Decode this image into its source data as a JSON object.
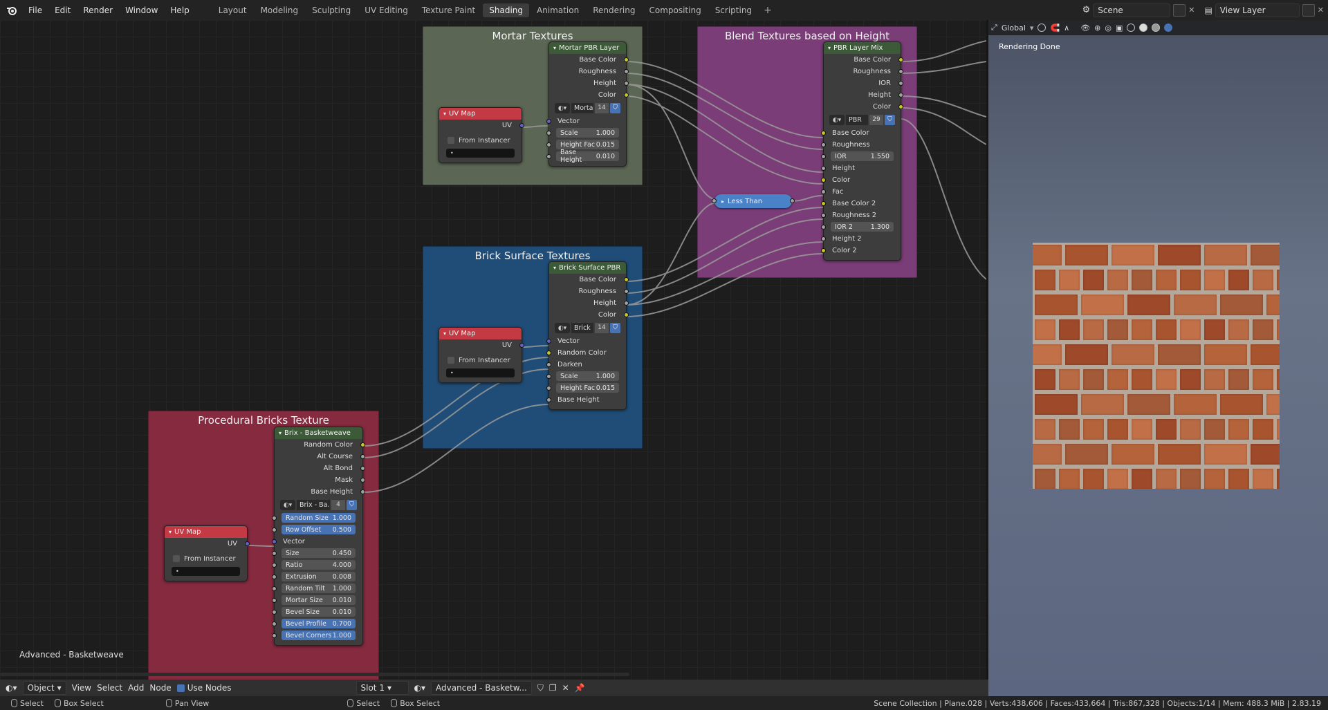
{
  "topbar": {
    "menus": [
      "File",
      "Edit",
      "Render",
      "Window",
      "Help"
    ],
    "workspaces": [
      "Layout",
      "Modeling",
      "Sculpting",
      "UV Editing",
      "Texture Paint",
      "Shading",
      "Animation",
      "Rendering",
      "Compositing",
      "Scripting"
    ],
    "active_workspace": "Shading",
    "scene": "Scene",
    "view_layer": "View Layer"
  },
  "frames": {
    "mortar": "Mortar Textures",
    "blend": "Blend Textures based on Height",
    "brick": "Brick Surface Textures",
    "proc": "Procedural Bricks Texture"
  },
  "mortar_node": {
    "title": "Mortar PBR Layer",
    "outputs": [
      "Base Color",
      "Roughness",
      "Height",
      "Color"
    ],
    "group_name": "Morta",
    "group_users": "14",
    "in_vector": "Vector",
    "fields": [
      {
        "label": "Scale",
        "value": "1.000"
      },
      {
        "label": "Height Fac",
        "value": "0.015"
      },
      {
        "label": "Base Height",
        "value": "0.010"
      }
    ]
  },
  "uvmap": {
    "title": "UV Map",
    "output": "UV",
    "from_instancer": "From Instancer",
    "uv_field": "•"
  },
  "brick_node": {
    "title": "Brick Surface PBR",
    "outputs": [
      "Base Color",
      "Roughness",
      "Height",
      "Color"
    ],
    "group_name": "Brick",
    "group_users": "14",
    "inputs": [
      "Vector",
      "Random Color",
      "Darken"
    ],
    "fields": [
      {
        "label": "Scale",
        "value": "1.000"
      },
      {
        "label": "Height Fac",
        "value": "0.015"
      }
    ],
    "in_base_height": "Base Height"
  },
  "mix_node": {
    "title": "PBR Layer Mix",
    "outputs": [
      "Base Color",
      "Roughness",
      "IOR",
      "Height",
      "Color"
    ],
    "group_name": "PBR",
    "group_users": "29",
    "inputs_a": [
      "Base Color",
      "Roughness"
    ],
    "ior": {
      "label": "IOR",
      "value": "1.550"
    },
    "inputs_b": [
      "Height",
      "Color",
      "Fac",
      "Base Color 2",
      "Roughness 2"
    ],
    "ior2": {
      "label": "IOR 2",
      "value": "1.300"
    },
    "inputs_c": [
      "Height 2",
      "Color 2"
    ]
  },
  "less_than": {
    "label": "Less Than"
  },
  "brix_node": {
    "title": "Brix - Basketweave",
    "outputs": [
      "Random Color",
      "Alt Course",
      "Alt Bond",
      "Mask",
      "Base Height"
    ],
    "group_name": "Brix - Ba...",
    "group_users": "4",
    "hl_fields": [
      {
        "label": "Random Size",
        "value": "1.000"
      },
      {
        "label": "Row Offset",
        "value": "0.500"
      }
    ],
    "in_vector": "Vector",
    "fields": [
      {
        "label": "Size",
        "value": "0.450"
      },
      {
        "label": "Ratio",
        "value": "4.000"
      },
      {
        "label": "Extrusion",
        "value": "0.008"
      },
      {
        "label": "Random Tilt",
        "value": "1.000"
      },
      {
        "label": "Mortar Size",
        "value": "0.010"
      },
      {
        "label": "Bevel Size",
        "value": "0.010"
      }
    ],
    "hl_fields2": [
      {
        "label": "Bevel Profile",
        "value": "0.700"
      },
      {
        "label": "Bevel Corners",
        "value": "1.000"
      }
    ]
  },
  "tree_name": "Advanced - Basketweave",
  "viewport": {
    "orientation": "Global",
    "status": "Rendering Done"
  },
  "footer": {
    "mode": "Object",
    "menus": [
      "View",
      "Select",
      "Add",
      "Node"
    ],
    "use_nodes": "Use Nodes",
    "slot": "Slot 1",
    "material": "Advanced - Basketw..."
  },
  "statusbar": {
    "hints": [
      "Select",
      "Box Select",
      "Pan View",
      "Select",
      "Box Select"
    ],
    "stats": "Scene Collection | Plane.028 | Verts:438,606 | Faces:433,664 | Tris:867,328 | Objects:1/14 | Mem: 488.3 MiB | 2.83.19"
  },
  "colors": {
    "mortar_frame": "#5c6654",
    "blend_frame": "#7a3d78",
    "brick_frame": "#1f4d77",
    "proc_frame": "#852a3f",
    "accent": "#4772b3"
  }
}
